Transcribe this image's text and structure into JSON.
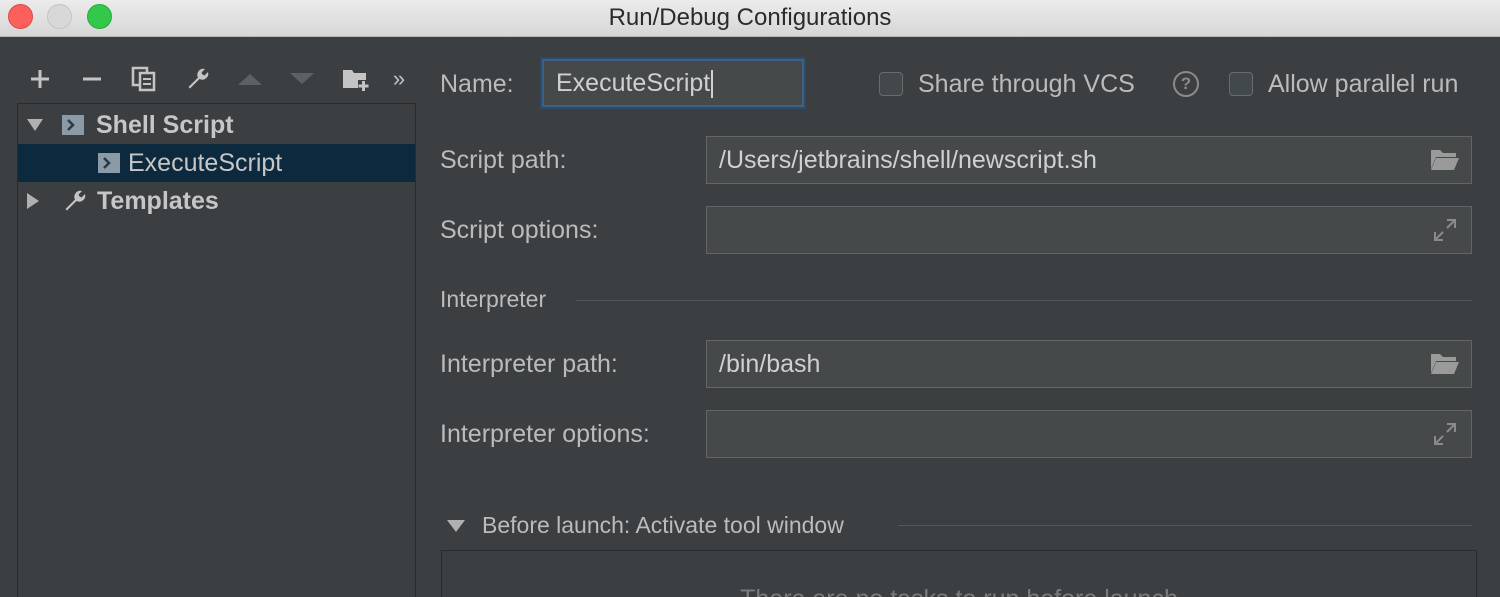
{
  "window": {
    "title": "Run/Debug Configurations"
  },
  "toolbar": {
    "buttons": [
      {
        "icon": "add-icon"
      },
      {
        "icon": "remove-icon"
      },
      {
        "icon": "copy-icon"
      },
      {
        "icon": "wrench-icon"
      },
      {
        "icon": "move-up-icon"
      },
      {
        "icon": "move-down-icon"
      },
      {
        "icon": "folder-add-icon"
      },
      {
        "icon": "more-chevron-icon",
        "label": "»"
      }
    ]
  },
  "tree": {
    "items": [
      {
        "label": "Shell Script",
        "expanded": true,
        "bold": true,
        "icon": "shell-script-icon"
      },
      {
        "label": "ExecuteScript",
        "selected": true,
        "icon": "shell-script-icon"
      },
      {
        "label": "Templates",
        "expanded": false,
        "bold": true,
        "icon": "wrench-icon"
      }
    ]
  },
  "form": {
    "name_label": "Name:",
    "name_value": "ExecuteScript",
    "share_vcs_label": "Share through VCS",
    "help_glyph": "?",
    "allow_parallel_label": "Allow parallel run",
    "script_path_label": "Script path:",
    "script_path_value": "/Users/jetbrains/shell/newscript.sh",
    "script_options_label": "Script options:",
    "script_options_value": "",
    "interpreter_section": "Interpreter",
    "interpreter_path_label": "Interpreter path:",
    "interpreter_path_value": "/bin/bash",
    "interpreter_options_label": "Interpreter options:",
    "interpreter_options_value": "",
    "before_launch_label": "Before launch: Activate tool window",
    "before_launch_empty": "There are no tasks to run before launch"
  },
  "colors": {
    "background": "#3c3f41",
    "selection": "#0d293e",
    "focus_border": "#3d6185"
  }
}
